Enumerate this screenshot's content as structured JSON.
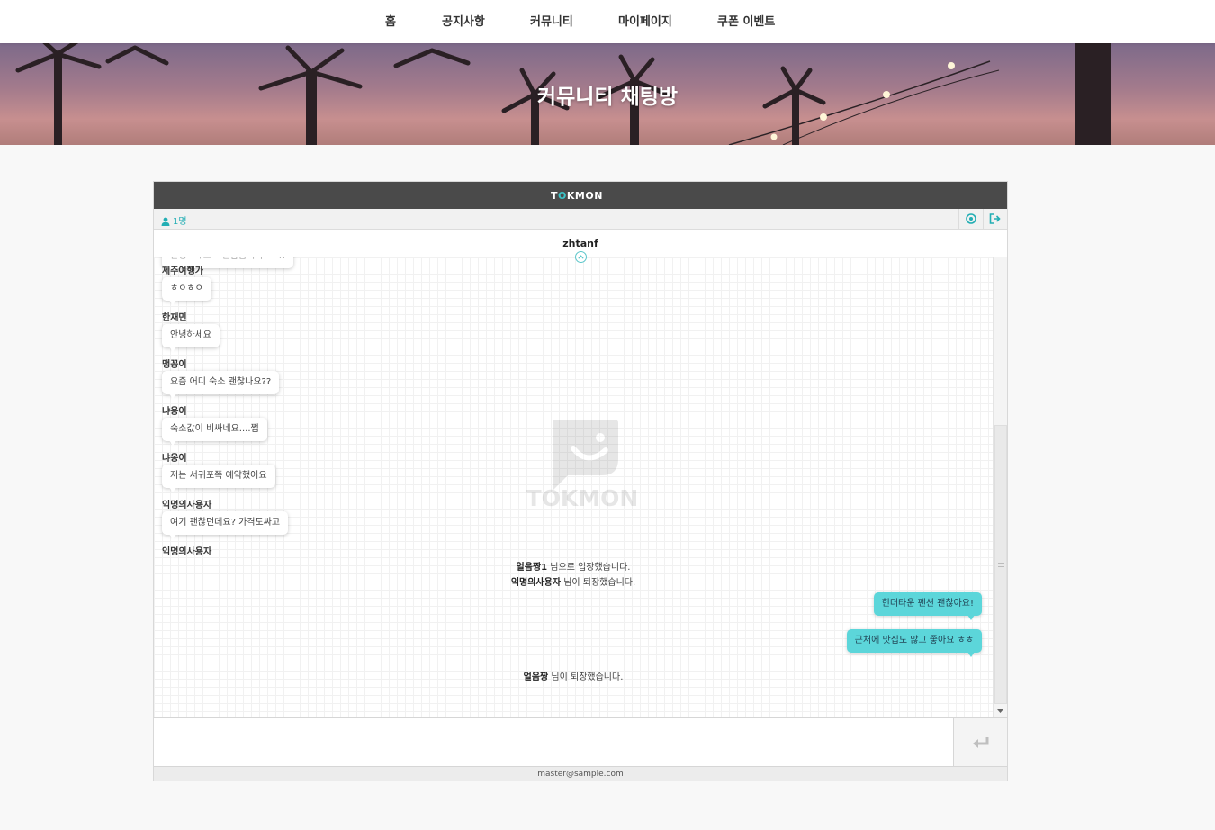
{
  "nav": {
    "items": [
      "홈",
      "공지사항",
      "커뮤니티",
      "마이페이지",
      "쿠폰 이벤트"
    ]
  },
  "hero": {
    "title": "커뮤니티 채팅방"
  },
  "chat": {
    "logo_prefix": "T",
    "logo_o": "O",
    "logo_suffix": "KMON",
    "watermark_text": "TOKMON",
    "user_count": "1명",
    "room_name": "zhtanf",
    "messages": [
      {
        "sender": "",
        "text": "안녕하세요~ 반갑습니다^^!!",
        "faded": true
      },
      {
        "sender": "제주여행가",
        "text": "ㅎㅇㅎㅇ"
      },
      {
        "sender": "한재민",
        "text": "안녕하세요"
      },
      {
        "sender": "맹꽁이",
        "text": "요즘 어디 숙소 괜찮나요??"
      },
      {
        "sender": "냐옹이",
        "text": "숙소값이 비싸네요....쩝"
      },
      {
        "sender": "냐옹이",
        "text": "저는 서귀포쪽 예약했어요"
      },
      {
        "sender": "익명의사용자",
        "text": "여기 괜찮던데요? 가격도싸고"
      },
      {
        "sender": "익명의사용자",
        "text": ""
      }
    ],
    "system_messages": [
      {
        "name": "얼음짱1",
        "text": " 님으로 입장했습니다."
      },
      {
        "name": "익명의사용자",
        "text": " 님이 퇴장했습니다."
      },
      {
        "name": "얼음짱",
        "text": " 님이 퇴장했습니다."
      }
    ],
    "my_messages": [
      "힌더타운 펜션 괜찮아요!",
      "근처에 맛집도 많고 좋아요 ㅎㅎ"
    ],
    "input_value": "",
    "footer_email": "master@sample.com"
  },
  "colors": {
    "accent": "#5cd6da",
    "accent_dark": "#22aeb4",
    "header_bg": "#4a4a4a"
  }
}
